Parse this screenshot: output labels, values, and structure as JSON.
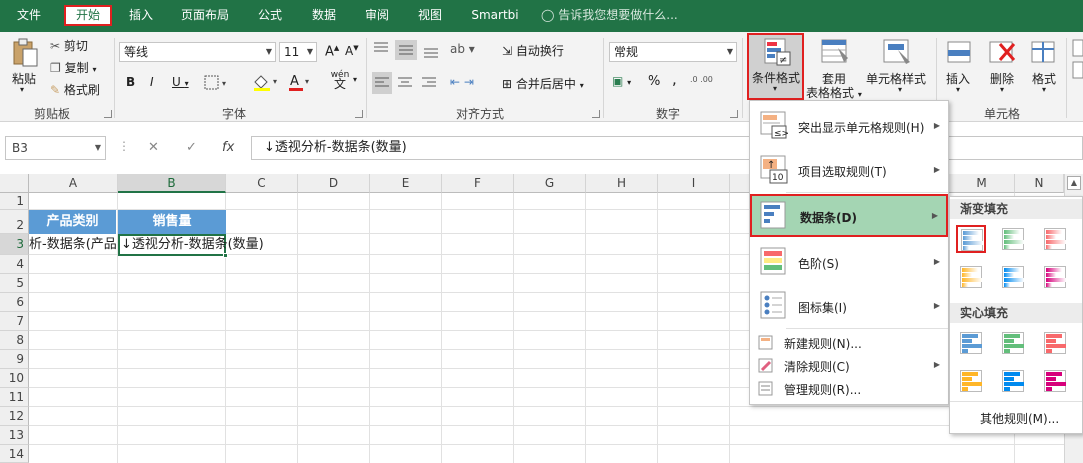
{
  "tabs": [
    "文件",
    "开始",
    "插入",
    "页面布局",
    "公式",
    "数据",
    "审阅",
    "视图",
    "Smartbi"
  ],
  "tell_me": "告诉我您想要做什么...",
  "ribbon": {
    "clipboard": {
      "paste": "粘贴",
      "cut": "剪切",
      "copy": "复制",
      "format_painter": "格式刷",
      "label": "剪贴板"
    },
    "font": {
      "name": "等线",
      "size": "11",
      "label": "字体",
      "wen": "wén",
      "wen_char": "文"
    },
    "alignment": {
      "wrap": "自动换行",
      "merge": "合并后居中",
      "label": "对齐方式"
    },
    "number": {
      "format": "常规",
      "label": "数字",
      "percent": "%",
      "comma": ","
    },
    "styles": {
      "conditional": "条件格式",
      "table_line1": "套用",
      "table_line2": "表格格式",
      "cell_style": "单元格样式"
    },
    "cells": {
      "insert": "插入",
      "delete": "删除",
      "format": "格式",
      "label": "单元格"
    }
  },
  "namebox": "B3",
  "formula": "↓透视分析-数据条(数量)",
  "columns": [
    "A",
    "B",
    "C",
    "D",
    "E",
    "F",
    "G",
    "H",
    "I",
    "M",
    "N"
  ],
  "rows": [
    "1",
    "2",
    "3",
    "4",
    "5",
    "6",
    "7",
    "8",
    "9",
    "10",
    "11",
    "12",
    "13",
    "14"
  ],
  "cells": {
    "a2": "产品类别",
    "b2": "销售量",
    "a3": "析-数据条(产品",
    "b3": "↓透视分析-数据条(数量)"
  },
  "menu": {
    "highlight": "突出显示单元格规则(H)",
    "topbottom": "项目选取规则(T)",
    "databars": "数据条(D)",
    "colorscales": "色阶(S)",
    "iconsets": "图标集(I)",
    "newrule": "新建规则(N)...",
    "clearrules": "清除规则(C)",
    "managerules": "管理规则(R)...",
    "icon_num": "10"
  },
  "submenu": {
    "gradient": "渐变填充",
    "solid": "实心填充",
    "more": "其他规则(M)...",
    "colors": [
      "#5b9bd5",
      "#63be7b",
      "#f8696b",
      "#ffb628",
      "#008aef",
      "#d6007b"
    ]
  }
}
